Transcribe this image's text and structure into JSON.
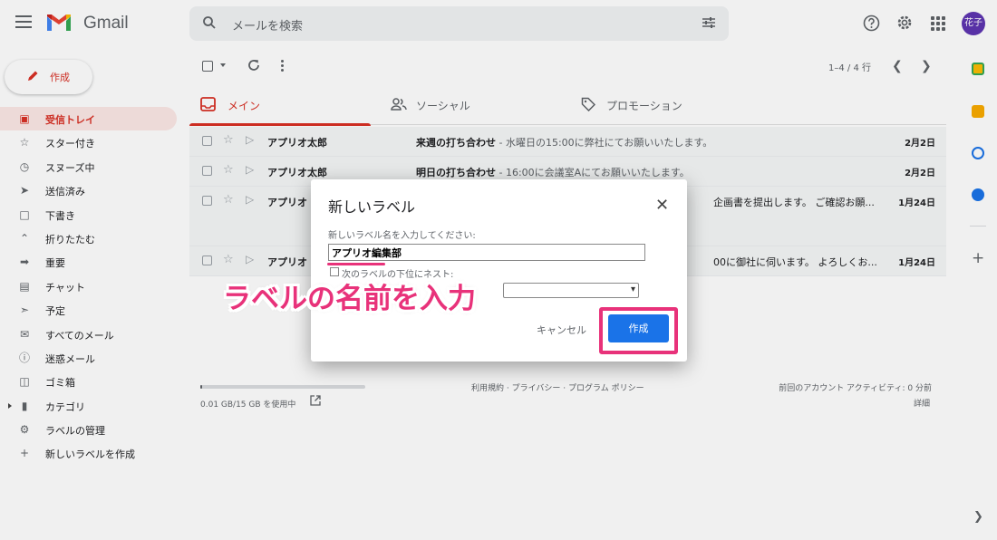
{
  "app": {
    "name": "Gmail",
    "search_placeholder": "メールを検索",
    "avatar_text": "花子",
    "colors": {
      "brand_red": "#d93025",
      "primary_blue": "#1a73e8",
      "annotation_pink": "#e8327a",
      "avatar_purple": "#5e35b1"
    }
  },
  "sidebar": {
    "compose_label": "作成",
    "items": [
      {
        "label": "受信トレイ",
        "icon": "inbox-icon",
        "active": true
      },
      {
        "label": "スター付き",
        "icon": "star-icon"
      },
      {
        "label": "スヌーズ中",
        "icon": "clock-icon"
      },
      {
        "label": "送信済み",
        "icon": "send-icon"
      },
      {
        "label": "下書き",
        "icon": "draft-icon"
      },
      {
        "label": "折りたたむ",
        "icon": "chevron-up-icon"
      },
      {
        "label": "重要",
        "icon": "important-icon"
      },
      {
        "label": "チャット",
        "icon": "chat-icon"
      },
      {
        "label": "予定",
        "icon": "scheduled-icon"
      },
      {
        "label": "すべてのメール",
        "icon": "all-mail-icon"
      },
      {
        "label": "迷惑メール",
        "icon": "spam-icon"
      },
      {
        "label": "ゴミ箱",
        "icon": "trash-icon"
      },
      {
        "label": "カテゴリ",
        "icon": "label-icon"
      },
      {
        "label": "ラベルの管理",
        "icon": "gear-icon"
      },
      {
        "label": "新しいラベルを作成",
        "icon": "plus-icon"
      }
    ]
  },
  "toolbar": {
    "pager": "1–4 / 4 行"
  },
  "tabs": [
    {
      "label": "メイン",
      "icon": "inbox-icon",
      "active": true
    },
    {
      "label": "ソーシャル",
      "icon": "people-icon"
    },
    {
      "label": "プロモーション",
      "icon": "tag-icon"
    }
  ],
  "emails": [
    {
      "from": "アプリオ太郎",
      "subject": "来週の打ち合わせ",
      "snippet": " - 水曜日の15:00に弊社にてお願いいたします。",
      "date": "2月2日"
    },
    {
      "from": "アプリオ太郎",
      "subject": "明日の打ち合わせ",
      "snippet": " - 16:00に会議室Aにてお願いいたします。",
      "date": "2月2日"
    },
    {
      "from": "アプリオ",
      "subject": "",
      "snippet": "企画書を提出します。 ご確認お願...",
      "date": "1月24日"
    },
    {
      "from": "アプリオ",
      "subject": "",
      "snippet": "00に御社に伺います。 よろしくお...",
      "date": "1月24日"
    }
  ],
  "footer": {
    "storage": "0.01 GB/15 GB を使用中",
    "storage_used_fraction": 0.001,
    "terms": "利用規約 · プライバシー · プログラム ポリシー",
    "activity": "前回のアカウント アクティビティ: 0 分前",
    "details": "詳細"
  },
  "dialog": {
    "title": "新しいラベル",
    "prompt": "新しいラベル名を入力してください:",
    "input_value": "アプリオ編集部",
    "nest_label": "次のラベルの下位にネスト:",
    "cancel": "キャンセル",
    "create": "作成"
  },
  "annotation": {
    "callout": "ラベルの名前を入力"
  }
}
